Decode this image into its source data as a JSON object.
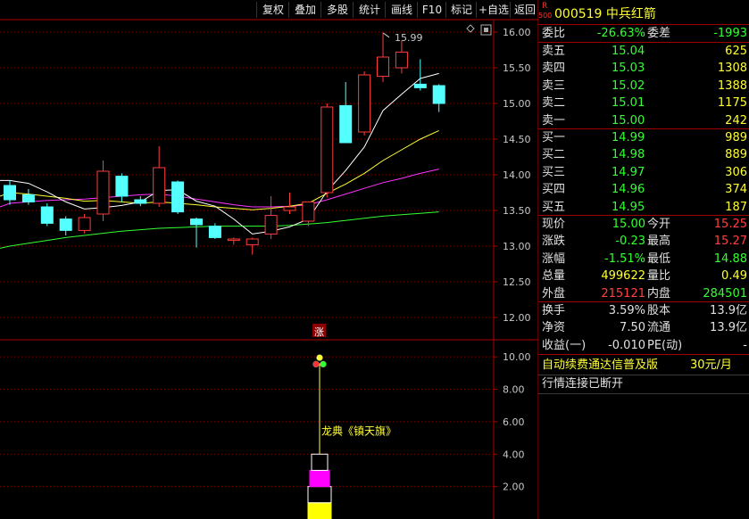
{
  "toolbar": {
    "buttons": [
      "复权",
      "叠加",
      "多股",
      "统计",
      "画线",
      "F10",
      "标记",
      "+自选",
      "返回"
    ]
  },
  "stock": {
    "badge_top": "R",
    "badge_bottom": "500",
    "code_name": "000519 中兵红箭"
  },
  "quote": {
    "wei_bi_label": "委比",
    "wei_bi": "-26.63%",
    "wei_cha_label": "委差",
    "wei_cha": "-1993",
    "asks": [
      {
        "label": "卖五",
        "price": "15.04",
        "vol": "625"
      },
      {
        "label": "卖四",
        "price": "15.03",
        "vol": "1308"
      },
      {
        "label": "卖三",
        "price": "15.02",
        "vol": "1388"
      },
      {
        "label": "卖二",
        "price": "15.01",
        "vol": "1175"
      },
      {
        "label": "卖一",
        "price": "15.00",
        "vol": "242"
      }
    ],
    "bids": [
      {
        "label": "买一",
        "price": "14.99",
        "vol": "989"
      },
      {
        "label": "买二",
        "price": "14.98",
        "vol": "889"
      },
      {
        "label": "买三",
        "price": "14.97",
        "vol": "306"
      },
      {
        "label": "买四",
        "price": "14.96",
        "vol": "374"
      },
      {
        "label": "买五",
        "price": "14.95",
        "vol": "187"
      }
    ],
    "stats": [
      {
        "l1": "现价",
        "v1": "15.00",
        "c1": "c-green",
        "l2": "今开",
        "v2": "15.25",
        "c2": "c-red"
      },
      {
        "l1": "涨跌",
        "v1": "-0.23",
        "c1": "c-green",
        "l2": "最高",
        "v2": "15.27",
        "c2": "c-red"
      },
      {
        "l1": "涨幅",
        "v1": "-1.51%",
        "c1": "c-green",
        "l2": "最低",
        "v2": "14.88",
        "c2": "c-green"
      },
      {
        "l1": "总量",
        "v1": "499622",
        "c1": "c-yellow",
        "l2": "量比",
        "v2": "0.49",
        "c2": "c-yellow"
      },
      {
        "l1": "外盘",
        "v1": "215121",
        "c1": "c-red",
        "l2": "内盘",
        "v2": "284501",
        "c2": "c-green"
      }
    ],
    "fundamentals": [
      {
        "l1": "换手",
        "v1": "3.59%",
        "l2": "股本",
        "v2": "13.9亿"
      },
      {
        "l1": "净资",
        "v1": "7.50",
        "l2": "流通",
        "v2": "13.9亿"
      },
      {
        "l1": "收益(一)",
        "v1": "-0.010",
        "l2": "PE(动)",
        "v2": "-"
      }
    ],
    "ad_text": "自动续费通达信普及版",
    "ad_price": "30元/月",
    "status_text": "行情连接已断开"
  },
  "colors": {
    "up": "#ff3c3c",
    "down": "#54ffff",
    "ma5": "#ffffff",
    "ma10": "#ffff33",
    "ma20": "#ff33ff",
    "ma60": "#33ff33",
    "grid": "#8b0000",
    "axis": "#b00000"
  },
  "chart_data": [
    {
      "type": "candlestick",
      "ylim": [
        11.7,
        16.15
      ],
      "y_ticks": [
        "16.00",
        "15.50",
        "15.00",
        "14.50",
        "14.00",
        "13.50",
        "13.00",
        "12.50",
        "12.00"
      ],
      "y_tick_values": [
        16.0,
        15.5,
        15.0,
        14.5,
        14.0,
        13.5,
        13.0,
        12.5,
        12.0
      ],
      "annotation_high": "15.99",
      "candles": [
        {
          "o": 13.85,
          "h": 13.92,
          "l": 13.58,
          "c": 13.65
        },
        {
          "o": 13.72,
          "h": 13.8,
          "l": 13.58,
          "c": 13.62
        },
        {
          "o": 13.55,
          "h": 13.6,
          "l": 13.28,
          "c": 13.32
        },
        {
          "o": 13.38,
          "h": 13.42,
          "l": 13.15,
          "c": 13.22
        },
        {
          "o": 13.22,
          "h": 13.45,
          "l": 13.18,
          "c": 13.4
        },
        {
          "o": 13.45,
          "h": 14.2,
          "l": 13.35,
          "c": 14.05
        },
        {
          "o": 13.98,
          "h": 14.02,
          "l": 13.62,
          "c": 13.7
        },
        {
          "o": 13.65,
          "h": 13.7,
          "l": 13.56,
          "c": 13.6
        },
        {
          "o": 13.6,
          "h": 14.4,
          "l": 13.55,
          "c": 14.1
        },
        {
          "o": 13.9,
          "h": 13.92,
          "l": 13.45,
          "c": 13.48
        },
        {
          "o": 13.38,
          "h": 13.4,
          "l": 12.98,
          "c": 13.3
        },
        {
          "o": 13.28,
          "h": 13.32,
          "l": 13.1,
          "c": 13.12
        },
        {
          "o": 13.08,
          "h": 13.12,
          "l": 13.02,
          "c": 13.1
        },
        {
          "o": 13.02,
          "h": 13.12,
          "l": 12.88,
          "c": 13.1
        },
        {
          "o": 13.17,
          "h": 13.7,
          "l": 13.1,
          "c": 13.43
        },
        {
          "o": 13.5,
          "h": 13.75,
          "l": 13.45,
          "c": 13.55
        },
        {
          "o": 13.35,
          "h": 13.62,
          "l": 13.28,
          "c": 13.62
        },
        {
          "o": 13.75,
          "h": 15.0,
          "l": 13.68,
          "c": 14.95
        },
        {
          "o": 14.97,
          "h": 15.3,
          "l": 14.45,
          "c": 14.45
        },
        {
          "o": 14.6,
          "h": 15.45,
          "l": 14.55,
          "c": 15.4
        },
        {
          "o": 15.38,
          "h": 15.99,
          "l": 15.3,
          "c": 15.65
        },
        {
          "o": 15.5,
          "h": 15.88,
          "l": 15.42,
          "c": 15.72
        },
        {
          "o": 15.27,
          "h": 15.62,
          "l": 15.18,
          "c": 15.22
        },
        {
          "o": 15.25,
          "h": 15.27,
          "l": 14.88,
          "c": 15.0
        }
      ],
      "ma5": [
        13.92,
        13.88,
        13.76,
        13.62,
        13.52,
        13.54,
        13.57,
        13.62,
        13.78,
        13.79,
        13.63,
        13.56,
        13.38,
        13.17,
        13.21,
        13.27,
        13.38,
        13.77,
        14.06,
        14.39,
        14.9,
        15.13,
        15.35,
        15.42
      ],
      "ma10": [
        13.75,
        13.73,
        13.7,
        13.67,
        13.63,
        13.64,
        13.62,
        13.6,
        13.62,
        13.6,
        13.58,
        13.55,
        13.53,
        13.51,
        13.53,
        13.56,
        13.6,
        13.74,
        13.87,
        14.02,
        14.2,
        14.35,
        14.5,
        14.62
      ],
      "ma20": [
        13.6,
        13.62,
        13.64,
        13.65,
        13.66,
        13.68,
        13.7,
        13.72,
        13.73,
        13.7,
        13.66,
        13.62,
        13.58,
        13.55,
        13.55,
        13.56,
        13.58,
        13.65,
        13.73,
        13.81,
        13.89,
        13.95,
        14.02,
        14.08
      ],
      "ma60": [
        13.0,
        13.04,
        13.08,
        13.12,
        13.15,
        13.18,
        13.21,
        13.23,
        13.25,
        13.26,
        13.27,
        13.28,
        13.28,
        13.28,
        13.28,
        13.29,
        13.31,
        13.33,
        13.36,
        13.39,
        13.42,
        13.44,
        13.46,
        13.48
      ]
    },
    {
      "type": "bar",
      "ylim": [
        0,
        11
      ],
      "y_ticks": [
        "10.00",
        "8.00",
        "6.00",
        "4.00",
        "2.00"
      ],
      "y_tick_values": [
        10,
        8,
        6,
        4,
        2
      ],
      "indicator_label": "龙典《镇天旗》",
      "marker_label": "涨",
      "flag_pole_top": 9.6,
      "flag_blocks": [
        {
          "from": 0.0,
          "to": 1.0,
          "color": "#ffff00",
          "fill": true
        },
        {
          "from": 1.0,
          "to": 2.0,
          "color": "#ffffff",
          "fill": false
        },
        {
          "from": 2.0,
          "to": 3.0,
          "color": "#ff00ff",
          "fill": true
        },
        {
          "from": 3.0,
          "to": 4.0,
          "color": "#ffffff",
          "fill": false
        }
      ]
    }
  ]
}
